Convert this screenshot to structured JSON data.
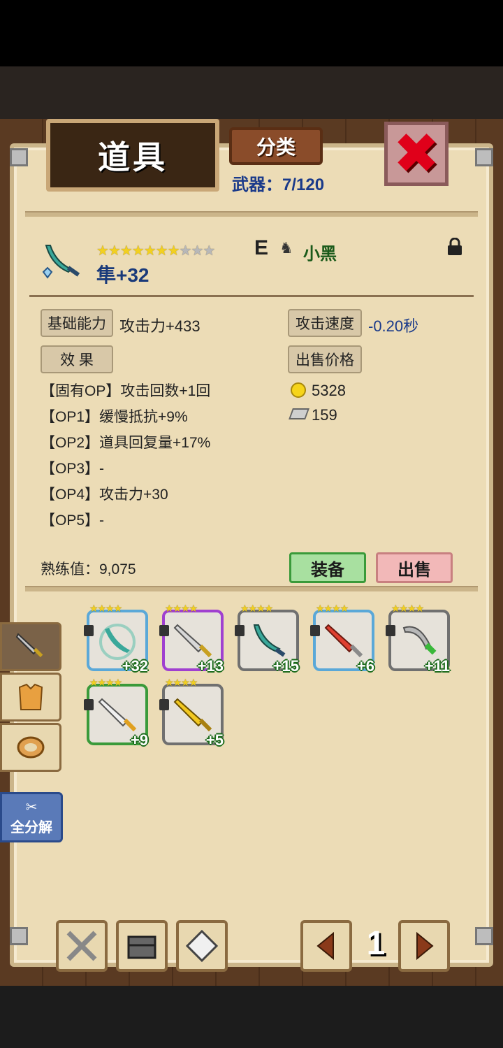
{
  "header": {
    "title": "道具",
    "category_button": "分类",
    "weapon_count": "武器：7/120"
  },
  "item": {
    "stars_filled": 7,
    "stars_total": 10,
    "grade": "E",
    "owner": "小黑",
    "name": "隼+32"
  },
  "stats": {
    "base_label": "基础能力",
    "base_value": "攻击力+433",
    "speed_label": "攻击速度",
    "speed_value": "-0.20秒",
    "effect_label": "效 果",
    "price_label": "出售价格",
    "gold": "5328",
    "stone": "159"
  },
  "options": [
    "【固有OP】攻击回数+1回",
    "【OP1】缓慢抵抗+9%",
    "【OP2】道具回复量+17%",
    "【OP3】-",
    "【OP4】攻击力+30",
    "【OP5】-"
  ],
  "mastery": "熟练值：9,075",
  "buttons": {
    "equip": "装备",
    "sell": "出售"
  },
  "inventory": [
    {
      "plus": "+32",
      "stars": "★★★★",
      "border": "#5aa8d8",
      "icon": "curved-blade-icon"
    },
    {
      "plus": "+13",
      "stars": "★★★★",
      "border": "#a040d0",
      "icon": "silver-sword-icon"
    },
    {
      "plus": "+15",
      "stars": "★★★★",
      "border": "#707070",
      "icon": "teal-scimitar-icon"
    },
    {
      "plus": "+6",
      "stars": "★★★★",
      "border": "#5aa8d8",
      "icon": "red-sword-icon"
    },
    {
      "plus": "+11",
      "stars": "★★★★",
      "border": "#707070",
      "icon": "green-scimitar-icon"
    },
    {
      "plus": "+9",
      "stars": "★★★★",
      "border": "#3a9a3a",
      "icon": "white-sword-icon"
    },
    {
      "plus": "+5",
      "stars": "★★★★",
      "border": "#707070",
      "icon": "gold-sword-icon"
    }
  ],
  "side": {
    "disassemble": "全分解"
  },
  "pager": {
    "page": "1"
  }
}
